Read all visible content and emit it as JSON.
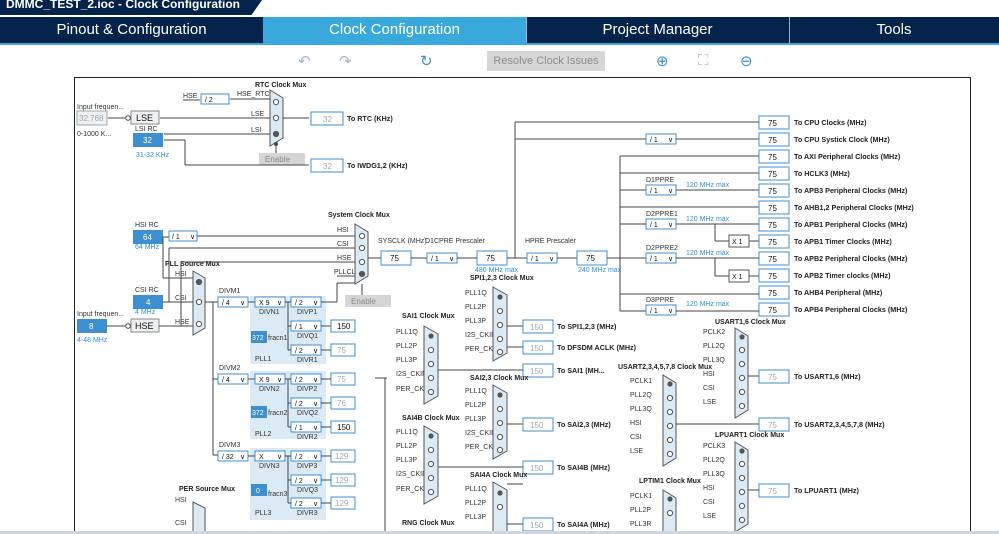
{
  "title": {
    "text": "DMMC_TEST_2.ioc - Clock Configuration"
  },
  "tabs": [
    {
      "label": "Pinout & Configuration",
      "active": false
    },
    {
      "label": "Clock Configuration",
      "active": true
    },
    {
      "label": "Project Manager",
      "active": false
    },
    {
      "label": "Tools",
      "active": false
    }
  ],
  "toolbar": {
    "undo_icon": "undo-icon",
    "redo_icon": "redo-icon",
    "reset_icon": "refresh-icon",
    "resolve_label": "Resolve Clock Issues",
    "zoom_in_icon": "zoom-in-icon",
    "fit_icon": "fit-screen-icon",
    "zoom_out_icon": "zoom-out-icon"
  },
  "colors": {
    "navy": "#03234b",
    "tab_active": "#39a9dc",
    "field_blue": "#3d8fd0",
    "panel_blue": "#dceaf6"
  },
  "lse": {
    "input_label": "Input frequen...",
    "value": "32.768",
    "range": "0-1000 K...",
    "name": "LSE"
  },
  "lsi": {
    "name": "LSI RC",
    "value": "32",
    "range": "31-32 KHz"
  },
  "rtc": {
    "mux_label": "RTC Clock Mux",
    "hse_label": "HSE",
    "div": "/ 2",
    "hse_rtc": "HSE_RTC",
    "lse": "LSE",
    "lsi": "LSI",
    "enable": "Enable",
    "value": "32",
    "output": "To RTC (KHz)"
  },
  "iwdg": {
    "value": "32",
    "output": "To IWDG1,2 (KHz)"
  },
  "hsi": {
    "name": "HSI RC",
    "value": "64",
    "sub": "64 MHz",
    "div": "/ 1"
  },
  "csi": {
    "name": "CSI RC",
    "value": "4",
    "sub": "4 MHz"
  },
  "hse": {
    "input_label": "Input frequen...",
    "value": "8",
    "range": "4-48 MHz",
    "name": "HSE"
  },
  "pll_source": {
    "title": "PLL Source Mux",
    "hsi": "HSI",
    "csi": "CSI",
    "hse": "HSE"
  },
  "sysmux": {
    "title": "System Clock Mux",
    "hsi": "HSI",
    "csi": "CSI",
    "hse": "HSE",
    "pllclk": "PLLCLK",
    "enable": "Enable"
  },
  "sysclk": {
    "label": "SYSCLK (MHz)",
    "value": "75",
    "d1cpre_label": "D1CPRE Prescaler",
    "d1cpre": "/ 1",
    "cpu_value": "75",
    "cpu_max": "480 MHz max",
    "hpre_label": "HPRE Prescaler",
    "hpre": "/ 1",
    "ahb_value": "75",
    "ahb_max": "240 MHz max",
    "systick_div": "/ 1"
  },
  "pll1": {
    "divm_label": "DIVM1",
    "divm": "/ 4",
    "divn": "X 9",
    "divn_label": "DIVN1",
    "divp": "/ 2",
    "divp_label": "DIVP1",
    "divq": "/ 1",
    "divq_label": "DIVQ1",
    "divq_value": "150",
    "divr": "/ 2",
    "divr_label": "DIVR1",
    "divr_value": "75",
    "frac": "372",
    "frac_label": "fracn1",
    "name": "PLL1"
  },
  "pll2": {
    "divm_label": "DIVM2",
    "divm": "/ 4",
    "divn": "X 9",
    "divn_label": "DIVN2",
    "divp": "/ 2",
    "divp_label": "DIVP2",
    "divp_value": "75",
    "divq": "/ 2",
    "divq_label": "DIVQ2",
    "divq_value": "76",
    "divr": "/ 1",
    "divr_label": "DIVR2",
    "divr_value": "150",
    "frac": "372",
    "frac_label": "fracn2",
    "name": "PLL2"
  },
  "pll3": {
    "divm_label": "DIVM3",
    "divm": "/ 32",
    "divn": "X",
    "divn_label": "DIVN3",
    "divp": "/ 2",
    "divp_label": "DIVP3",
    "divp_value": "129",
    "divq": "/ 2",
    "divq_label": "DIVQ3",
    "divq_value": "129",
    "divr": "/ 2",
    "divr_label": "DIVR3",
    "divr_value": "129",
    "frac": "0",
    "frac_label": "fracn3",
    "name": "PLL3"
  },
  "per": {
    "title": "PER Source Mux",
    "hsi": "HSI",
    "csi": "CSI"
  },
  "prescalers": {
    "d1ppre_label": "D1PPRE",
    "d1ppre": "/ 1",
    "d2ppre1_label": "D2PPRE1",
    "d2ppre1": "/ 1",
    "d2ppre2_label": "D2PPRE2",
    "d2ppre2": "/ 1",
    "d3ppre_label": "D3PPRE",
    "d3ppre": "/ 1",
    "max_120": "120 MHz max",
    "x1": "X 1"
  },
  "outputs": [
    {
      "value": "75",
      "label": "To CPU Clocks (MHz)"
    },
    {
      "value": "75",
      "label": "To CPU Systick Clock (MHz)"
    },
    {
      "value": "75",
      "label": "To AXI Peripheral Clocks (MHz)"
    },
    {
      "value": "75",
      "label": "To HCLK3 (MHz)"
    },
    {
      "value": "75",
      "label": "To APB3 Peripheral Clocks (MHz)"
    },
    {
      "value": "75",
      "label": "To AHB1,2 Peripheral Clocks (MHz)"
    },
    {
      "value": "75",
      "label": "To APB1 Peripheral Clocks (MHz)"
    },
    {
      "value": "75",
      "label": "To APB1 Timer Clocks (MHz)"
    },
    {
      "value": "75",
      "label": "To APB2 Peripheral Clocks (MHz)"
    },
    {
      "value": "75",
      "label": "To APB2 Timer clocks (MHz)"
    },
    {
      "value": "75",
      "label": "To AHB4 Peripheral (MHz)"
    },
    {
      "value": "75",
      "label": "To APB4 Peripheral Clocks (MHz)"
    }
  ],
  "spi123": {
    "title": "SPI1,2,3 Clock Mux",
    "inputs": [
      "PLL1Q",
      "PLL2P",
      "PLL3P",
      "I2S_CKIN",
      "PER_CK"
    ],
    "value": "150",
    "output": "To SPI1,2,3 (MHz)"
  },
  "dfsdm": {
    "value": "150",
    "output": "To DFSDM ACLK (MHz)"
  },
  "sai1": {
    "title": "SAI1 Clock Mux",
    "inputs": [
      "PLL1Q",
      "PLL2P",
      "PLL3P",
      "I2S_CKIN",
      "PER_CK"
    ],
    "value": "150",
    "output": "To SAI1 (MH..."
  },
  "sai23": {
    "title": "SAI2,3 Clock Mux",
    "inputs": [
      "PLL1Q",
      "PLL2P",
      "PLL3P",
      "I2S_CKIN",
      "PER_CK"
    ],
    "value": "150",
    "output": "To SAI2,3 (MHz)"
  },
  "sai4b": {
    "title": "SAI4B Clock Mux",
    "inputs": [
      "PLL1Q",
      "PLL2P",
      "PLL3P",
      "I2S_CKIN",
      "PER_CK"
    ],
    "value": "150",
    "output": "To SAI4B (MHz)"
  },
  "sai4a": {
    "title": "SAI4A Clock Mux",
    "inputs": [
      "PLL1Q",
      "PLL2P",
      "PLL3P"
    ],
    "value": "150",
    "output": "To SAI4A (MHz)"
  },
  "rng": {
    "title": "RNG Clock Mux"
  },
  "usart16": {
    "title": "USART1,6 Clock Mux",
    "inputs": [
      "PCLK2",
      "PLL2Q",
      "PLL3Q",
      "HSI",
      "CSI",
      "LSE"
    ],
    "value": "75",
    "output": "To USART1,6 (MHz)"
  },
  "usart2": {
    "title": "USART2,3,4,5,7,8 Clock Mux",
    "inputs": [
      "PCLK1",
      "PLL2Q",
      "PLL3Q",
      "HSI",
      "CSI",
      "LSE"
    ],
    "value": "75",
    "output": "To USART2,3,4,5,7,8 (MHz)"
  },
  "lpuart1": {
    "title": "LPUART1 Clock Mux",
    "inputs": [
      "PCLK3",
      "PLL2Q",
      "PLL3Q",
      "HSI",
      "CSI",
      "LSE"
    ],
    "value": "75",
    "output": "To LPUART1 (MHz)"
  },
  "lptim1": {
    "title": "LPTIM1 Clock Mux",
    "inputs": [
      "PCLK1",
      "PLL2P",
      "PLL3R"
    ]
  }
}
